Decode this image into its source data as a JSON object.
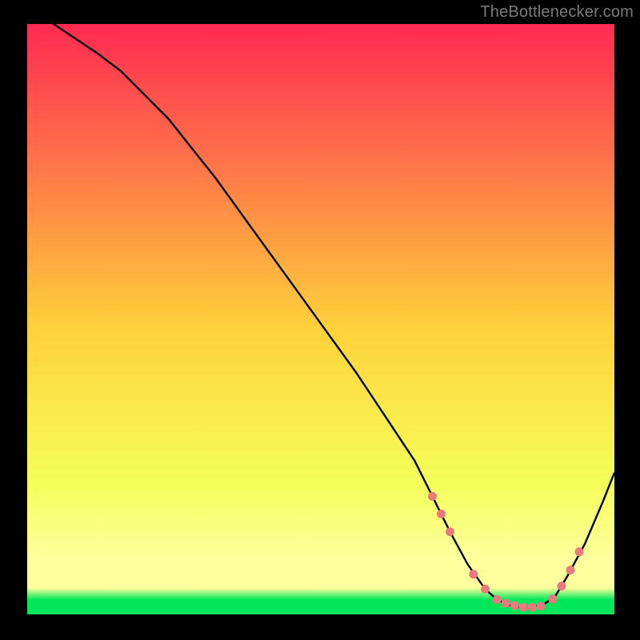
{
  "attribution": "TheBottlenecker.com",
  "colors": {
    "bg_black": "#000000",
    "grad_top": "#ff2a52",
    "grad_mid_upper": "#ff6f4a",
    "grad_mid": "#ffd23a",
    "grad_lower": "#f4ff5a",
    "grad_bottom_band": "#ffff9e",
    "grad_green": "#00e85a",
    "curve": "#000000",
    "dots": "#e77b7b"
  },
  "chart_data": {
    "type": "line",
    "title": "",
    "xlabel": "",
    "ylabel": "",
    "xlim": [
      0,
      100
    ],
    "ylim": [
      0,
      100
    ],
    "series": [
      {
        "name": "bottleneck-curve",
        "x": [
          3,
          6,
          9,
          12,
          16,
          24,
          32,
          40,
          48,
          56,
          62,
          66,
          69,
          72,
          75,
          78,
          80,
          82,
          84,
          86,
          88,
          90,
          92,
          95,
          98,
          100
        ],
        "y": [
          101,
          99,
          97,
          95,
          92,
          84,
          74,
          63,
          52,
          41,
          32,
          26,
          20,
          14,
          8.5,
          4.3,
          2.5,
          1.6,
          1.2,
          1.2,
          1.7,
          3.2,
          6.5,
          12,
          19,
          24
        ]
      }
    ],
    "markers": {
      "name": "optimal-range-dots",
      "x": [
        69,
        70.5,
        72,
        76,
        78,
        80,
        81.5,
        83,
        84.5,
        86,
        87.5,
        89.5,
        91,
        92.5,
        94
      ],
      "y": [
        20,
        17,
        14,
        6.8,
        4.3,
        2.5,
        1.9,
        1.5,
        1.2,
        1.2,
        1.4,
        2.6,
        4.8,
        7.5,
        10.6
      ]
    }
  }
}
